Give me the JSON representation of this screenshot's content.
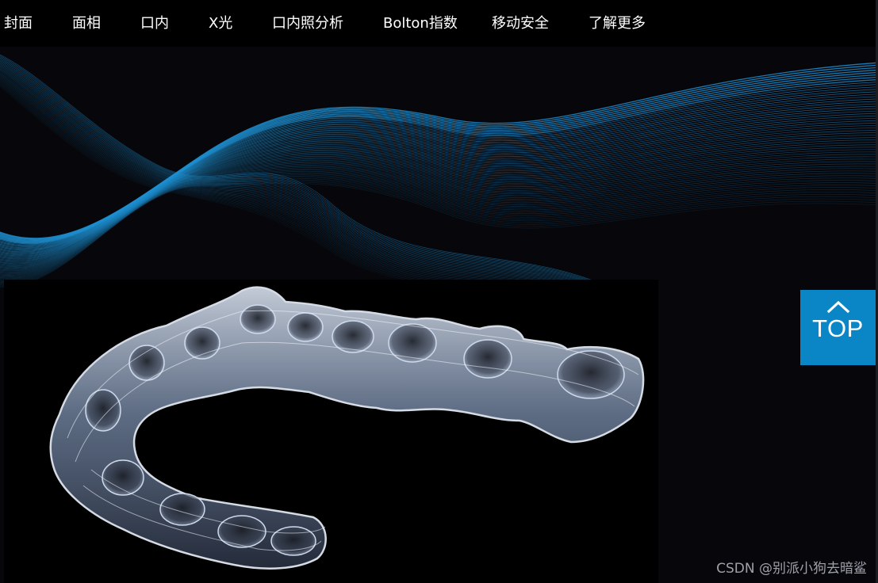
{
  "nav": {
    "items": [
      {
        "label": "封面"
      },
      {
        "label": "面相"
      },
      {
        "label": "口内"
      },
      {
        "label": "X光"
      },
      {
        "label": "口内照分析"
      },
      {
        "label": "Bolton指数"
      },
      {
        "label": "移动安全"
      },
      {
        "label": "了解更多"
      }
    ]
  },
  "top_button": {
    "label": "TOP",
    "icon": "chevron-up-icon"
  },
  "watermark": {
    "text": "CSDN @别派小狗去暗鲨"
  },
  "colors": {
    "nav_background": "#000000",
    "page_background": "#07070b",
    "accent": "#0a86c7",
    "wave_lines": "#1e8fd0"
  }
}
